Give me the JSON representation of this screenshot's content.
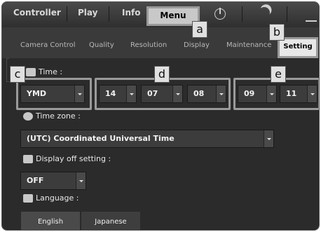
{
  "top_tabs": {
    "controller": "Controller",
    "play": "Play",
    "info": "Info",
    "menu": "Menu"
  },
  "sub_tabs": {
    "camera_control": "Camera Control",
    "quality": "Quality",
    "resolution": "Resolution",
    "display": "Display",
    "maintenance": "Maintenance",
    "setting": "Setting"
  },
  "callouts": {
    "a": "a",
    "b": "b",
    "c": "c",
    "d": "d",
    "e": "e"
  },
  "time": {
    "label": "Time :",
    "date_format": "YMD",
    "year": "14",
    "month": "07",
    "day": "08",
    "hour": "09",
    "minute": "11"
  },
  "timezone": {
    "label": "Time zone :",
    "value": "(UTC) Coordinated Universal Time"
  },
  "display_off": {
    "label": "Display off setting :",
    "value": "OFF"
  },
  "language": {
    "label": "Language :",
    "english": "English",
    "japanese": "Japanese"
  }
}
